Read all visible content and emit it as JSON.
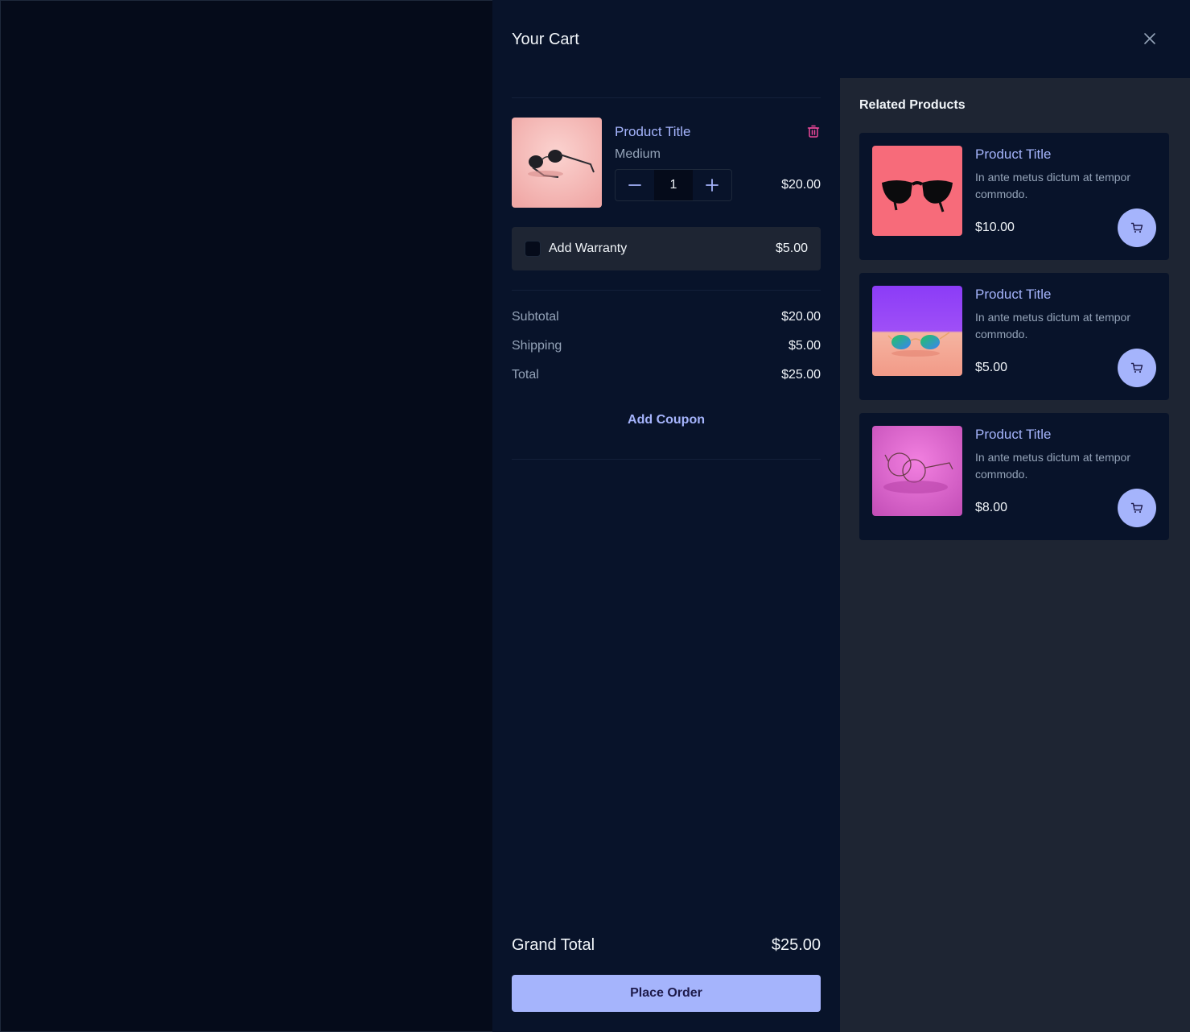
{
  "drawer": {
    "title": "Your Cart"
  },
  "cart_item": {
    "title": "Product Title",
    "variant": "Medium",
    "quantity": "1",
    "price": "$20.00"
  },
  "warranty": {
    "label": "Add Warranty",
    "price": "$5.00"
  },
  "summary": {
    "subtotal_label": "Subtotal",
    "subtotal_value": "$20.00",
    "shipping_label": "Shipping",
    "shipping_value": "$5.00",
    "total_label": "Total",
    "total_value": "$25.00"
  },
  "coupon_label": "Add Coupon",
  "grand_total": {
    "label": "Grand Total",
    "value": "$25.00"
  },
  "place_order_label": "Place Order",
  "related": {
    "title": "Related Products",
    "items": [
      {
        "title": "Product Title",
        "description": "In ante metus dictum at tempor commodo.",
        "price": "$10.00"
      },
      {
        "title": "Product Title",
        "description": "In ante metus dictum at tempor commodo.",
        "price": "$5.00"
      },
      {
        "title": "Product Title",
        "description": "In ante metus dictum at tempor commodo.",
        "price": "$8.00"
      }
    ]
  },
  "colors": {
    "accent": "#a5b4fc",
    "drawer_bg": "#08132a",
    "related_bg": "#1e2533",
    "trash": "#ec4899"
  },
  "icons": [
    "close-icon",
    "trash-icon",
    "minus-icon",
    "plus-icon",
    "cart-icon"
  ]
}
